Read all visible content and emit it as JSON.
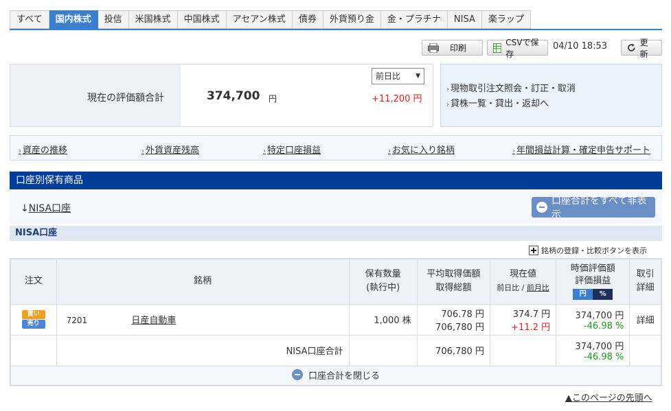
{
  "tabs": [
    "すべて",
    "国内株式",
    "投信",
    "米国株式",
    "中国株式",
    "アセアン株式",
    "債券",
    "外貨預り金",
    "金・プラチナ",
    "NISA",
    "楽ラップ"
  ],
  "toolbar": {
    "print_label": "印刷",
    "csv_label": "CSVで保存",
    "timestamp": "04/10 18:53",
    "refresh_label": "更新"
  },
  "evaluation": {
    "label": "現在の評価額合計",
    "amount": "374,700",
    "unit": "円",
    "compare_select": "前日比",
    "diff": "+11,200 円"
  },
  "side_links": [
    "現物取引注文照会・訂正・取消",
    "貸株一覧・貸出・返却へ"
  ],
  "link_bar": [
    "資産の推移",
    "外貨資産残高",
    "特定口座損益",
    "お気に入り銘柄",
    "年間損益計算・確定申告サポート"
  ],
  "section_title": "口座別保有商品",
  "account": {
    "link_prefix": "↓",
    "link_label": "NISA口座",
    "hide_all_button": "口座合計をすべて非表示",
    "header": "NISA口座",
    "register_link": "銘柄の登録・比較ボタンを表示"
  },
  "table": {
    "headers": {
      "order": "注文",
      "symbol": "銘柄",
      "qty1": "保有数量",
      "qty2": "(執行中)",
      "avg1": "平均取得価額",
      "avg2": "取得総額",
      "cur1": "現在値",
      "cur_sub1": "前日比",
      "cur_sep": " / ",
      "cur_sub2": "前月比",
      "val1": "時価評価額",
      "val2": "評価損益",
      "toggle_yen": "円",
      "toggle_pct": "%",
      "trade1": "取引",
      "trade2": "詳細"
    },
    "row": {
      "buy": "買い",
      "sell": "売り",
      "code": "7201",
      "name": "日産自動車",
      "qty": "1,000 株",
      "avg_price": "706.78 円",
      "total_cost": "706,780 円",
      "current": "374.7 円",
      "change": "+11.2 円",
      "market_value": "374,700 円",
      "pl_pct": "-46.98 %",
      "detail": "詳細"
    },
    "total": {
      "label": "NISA口座合計",
      "total_cost": "706,780 円",
      "market_value": "374,700 円",
      "pl_pct": "-46.98 %"
    },
    "close_label": "口座合計を閉じる"
  },
  "page_top_link": "▲このページの先頭へ"
}
